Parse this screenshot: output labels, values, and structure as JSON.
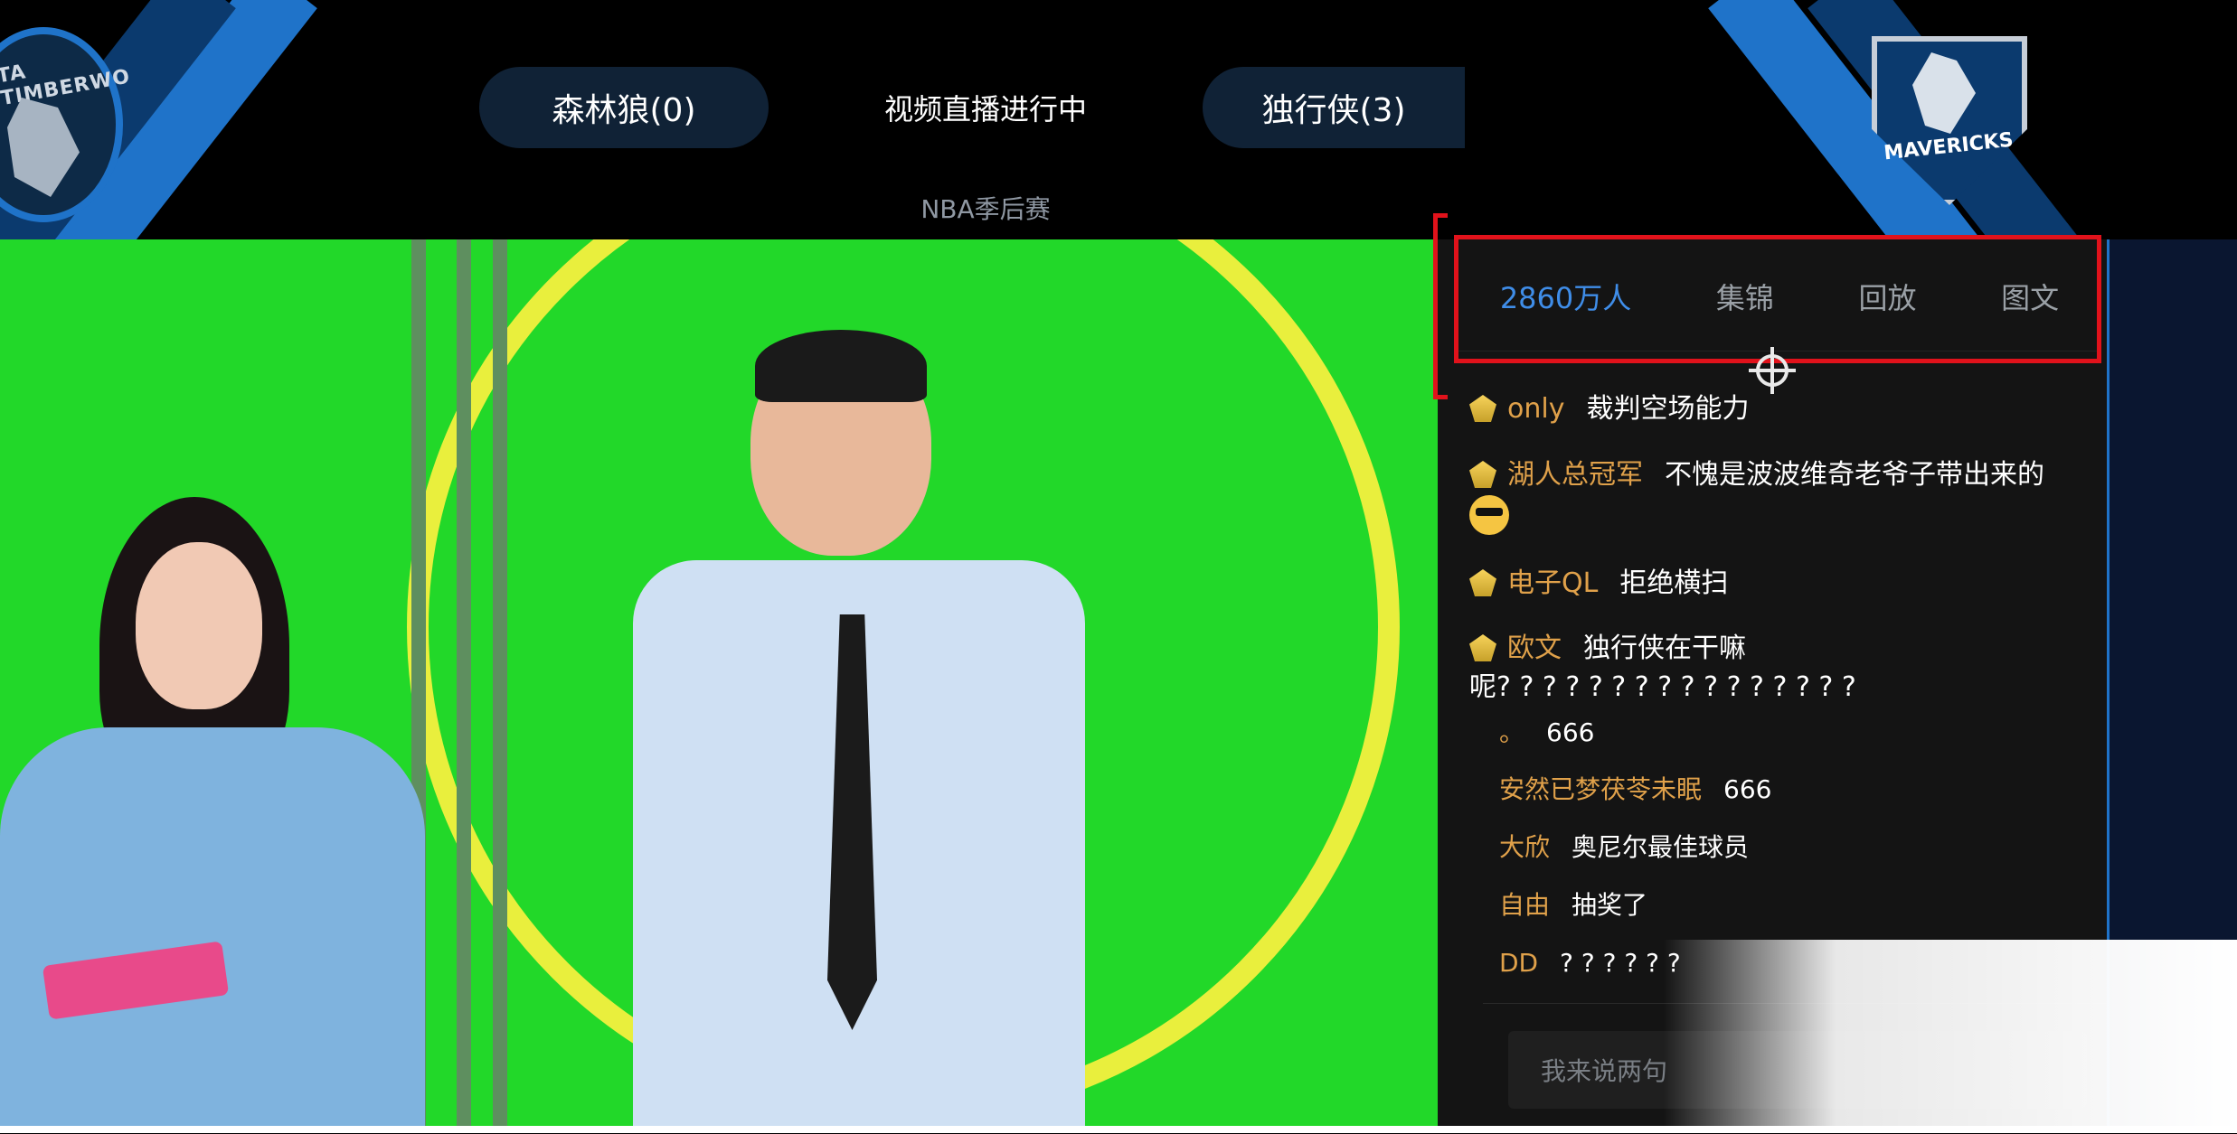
{
  "header": {
    "left_team": "森林狼(0)",
    "status": "视频直播进行中",
    "right_team": "独行侠(3)",
    "subtitle": "NBA季后赛",
    "left_logo_text": "TA TIMBERWO",
    "right_logo_text": "MAVERICKS"
  },
  "tabs": [
    {
      "label": "2860万人",
      "active": true
    },
    {
      "label": "集锦",
      "active": false
    },
    {
      "label": "回放",
      "active": false
    },
    {
      "label": "图文",
      "active": false
    }
  ],
  "chat": {
    "messages": [
      {
        "user": "only",
        "text": "裁判空场能力"
      },
      {
        "user": "湖人总冠军",
        "text": "不愧是波波维奇老爷子带出来的"
      },
      {
        "user": "电子QL",
        "text": "拒绝横扫"
      },
      {
        "user": "欧文",
        "text": "独行侠在干嘛"
      }
    ],
    "overflow_line": "呢? ? ? ? ? ? ? ? ? ? ? ? ? ? ? ?",
    "plain_messages": [
      {
        "user": "。",
        "text": "666"
      },
      {
        "user": "安然已梦茯苓未眠",
        "text": "666"
      },
      {
        "user": "大欣",
        "text": "奥尼尔最佳球员"
      },
      {
        "user": "自由",
        "text": "抽奖了"
      },
      {
        "user": "DD",
        "text": "? ? ? ? ? ?"
      }
    ],
    "input_placeholder": "我来说两句"
  },
  "colors": {
    "accent_blue": "#3f8de8",
    "highlight_red": "#e1121b",
    "username": "#e0a14a",
    "green_screen": "#22d829"
  }
}
